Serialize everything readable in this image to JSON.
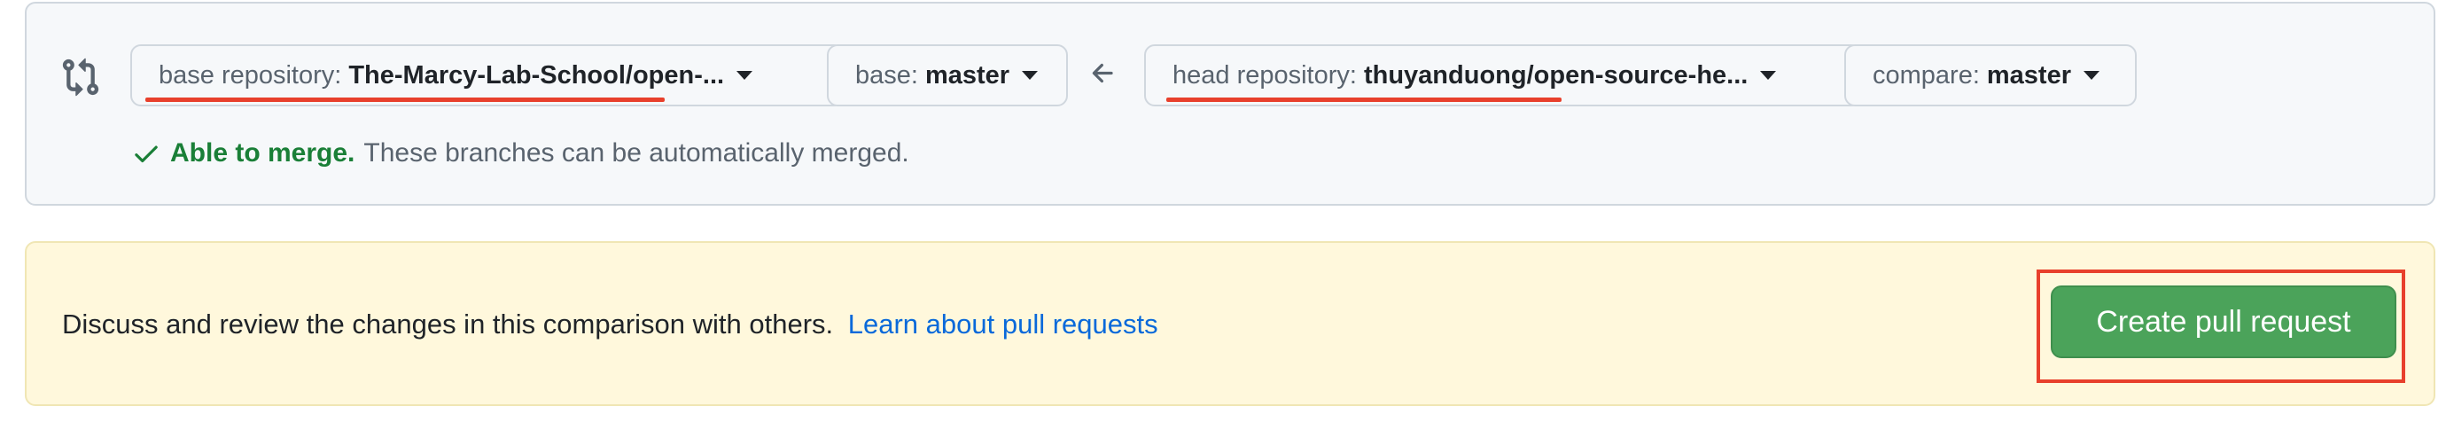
{
  "compare": {
    "base_repo": {
      "label": "base repository:",
      "value": "The-Marcy-Lab-School/open-..."
    },
    "base_branch": {
      "label": "base:",
      "value": "master"
    },
    "head_repo": {
      "label": "head repository:",
      "value": "thuyanduong/open-source-he..."
    },
    "compare_branch": {
      "label": "compare:",
      "value": "master"
    },
    "merge_status": {
      "ok_text": "Able to merge.",
      "description": "These branches can be automatically merged."
    }
  },
  "banner": {
    "text": "Discuss and review the changes in this comparison with others.",
    "link": "Learn about pull requests",
    "create_button": "Create pull request"
  },
  "colors": {
    "success": "#1a7f37",
    "link": "#0969da",
    "create_button_bg": "#4ba35a",
    "annotation_red": "#e8402c",
    "banner_bg": "#fff8dc"
  },
  "icons": {
    "compare": "git-compare-icon",
    "arrow": "arrow-left-icon",
    "check": "check-icon",
    "caret": "caret-down-icon"
  }
}
